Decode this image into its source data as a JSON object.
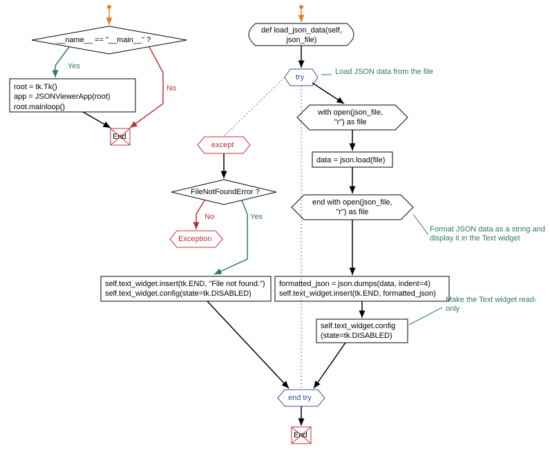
{
  "diagram": {
    "left": {
      "decision": "__name__ == \"__main__\" ?",
      "yes": "Yes",
      "no": "No",
      "block": "root = tk.Tk()\napp = JSONViewerApp(root)\nroot.mainloop()",
      "end": "End"
    },
    "right": {
      "func_def": "def load_json_data(self,\njson_file)",
      "try": "try",
      "with_open": "with open(json_file,\n\"r\") as file",
      "data_load": "data = json.load(file)",
      "end_with": "end with open(json_file,\n\"r\") as file",
      "formatted": "formatted_json = json.dumps(data, indent=4)\nself.text_widget.insert(tk.END, formatted_json)",
      "config_ro": "self.text_widget.config\n(state=tk.DISABLED)",
      "end_try": "end try",
      "end": "End"
    },
    "except": {
      "label": "except",
      "decision": "FileNotFoundError ?",
      "yes": "Yes",
      "no": "No",
      "exception": "Exception",
      "block": "self.text_widget.insert(tk.END, \"File not found.\")\nself.text_widget.config(state=tk.DISABLED)"
    },
    "annotations": {
      "load_comment": "Load JSON data\nfrom the file",
      "format_comment": "Format JSON data as a\nstring and display it in\nthe Text widget",
      "readonly_comment": "Make the Text\nwidget read-only"
    }
  }
}
